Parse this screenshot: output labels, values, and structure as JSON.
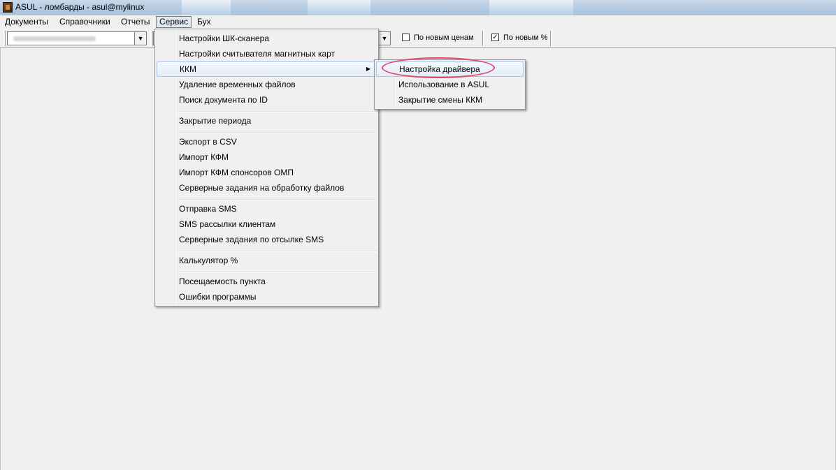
{
  "window": {
    "title": "ASUL - ломбарды - asul@mylinux"
  },
  "menubar": {
    "items": [
      {
        "label": "Документы"
      },
      {
        "label": "Справочники"
      },
      {
        "label": "Отчеты"
      },
      {
        "label": "Сервис",
        "open": true
      },
      {
        "label": "Бух"
      }
    ]
  },
  "toolbar": {
    "checkbox_new_prices": {
      "label": "По новым ценам",
      "checked": false
    },
    "checkbox_new_percent": {
      "label": "По новым %",
      "checked": true
    }
  },
  "service_menu": {
    "items": [
      {
        "label": "Настройки ШК-сканера"
      },
      {
        "label": "Настройки считывателя магнитных карт"
      },
      {
        "label": "ККМ",
        "submenu": true,
        "highlighted": true
      },
      {
        "label": "Удаление временных файлов"
      },
      {
        "label": "Поиск документа по ID"
      },
      {
        "label": "Закрытие периода"
      },
      {
        "label": "Экспорт в CSV"
      },
      {
        "label": "Импорт КФМ"
      },
      {
        "label": "Импорт КФМ спонсоров ОМП"
      },
      {
        "label": "Серверные задания на обработку файлов"
      },
      {
        "label": "Отправка SMS"
      },
      {
        "label": "SMS рассылки клиентам"
      },
      {
        "label": "Серверные задания по отсылке SMS"
      },
      {
        "label": "Калькулятор %"
      },
      {
        "label": "Посещаемость пункта"
      },
      {
        "label": "Ошибки программы"
      }
    ]
  },
  "kkm_submenu": {
    "items": [
      {
        "label": "Настройка драйвера",
        "highlighted": true,
        "annotated": true
      },
      {
        "label": "Использование в ASUL"
      },
      {
        "label": "Закрытие смены ККМ"
      }
    ]
  },
  "colors": {
    "annotation_ellipse": "#e0476a",
    "menu_highlight_border": "#aac5e8"
  },
  "icons": {
    "submenu_arrow": "triangle-right",
    "checkmark": "check"
  }
}
